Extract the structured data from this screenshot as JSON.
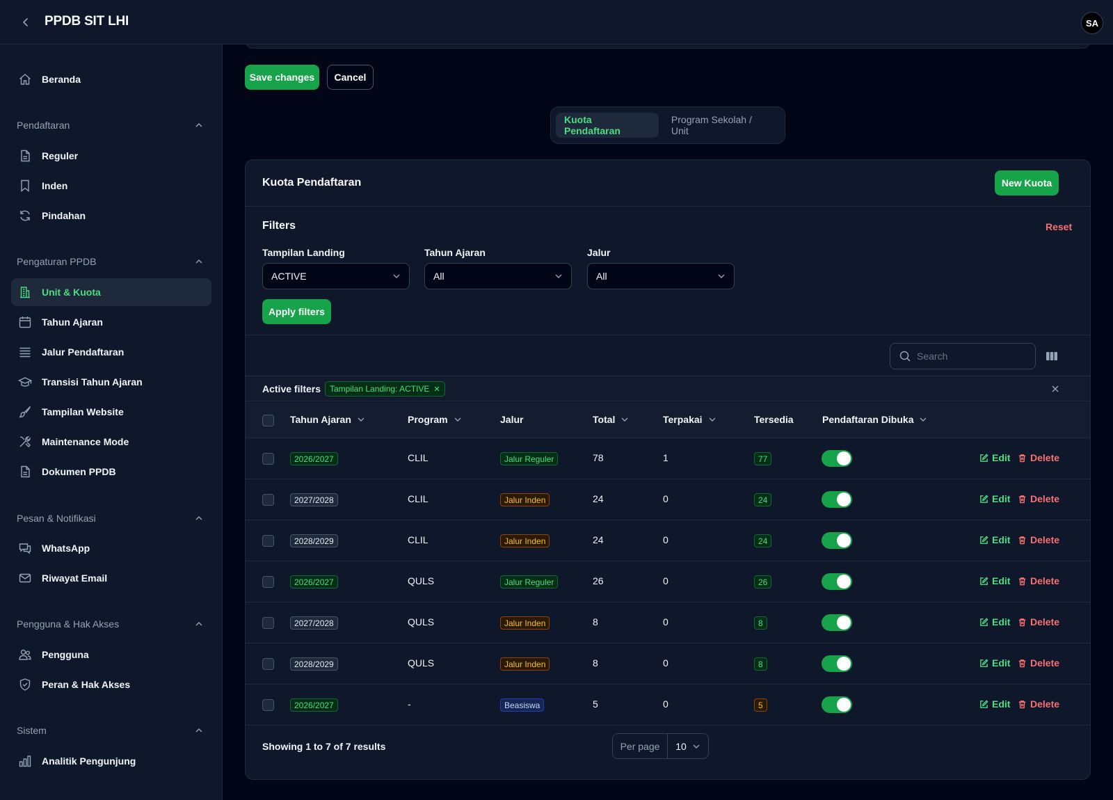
{
  "app": {
    "title": "PPDB SIT LHI",
    "avatar_initials": "SA"
  },
  "sidebar": {
    "home": {
      "label": "Beranda",
      "icon": "home-icon"
    },
    "groups": [
      {
        "label": "Pendaftaran",
        "items": [
          {
            "label": "Reguler",
            "icon": "document-icon"
          },
          {
            "label": "Inden",
            "icon": "bookmark-icon"
          },
          {
            "label": "Pindahan",
            "icon": "refresh-icon"
          }
        ]
      },
      {
        "label": "Pengaturan PPDB",
        "items": [
          {
            "label": "Unit & Kuota",
            "icon": "building-icon",
            "active": true
          },
          {
            "label": "Tahun Ajaran",
            "icon": "calendar-icon"
          },
          {
            "label": "Jalur Pendaftaran",
            "icon": "list-icon"
          },
          {
            "label": "Transisi Tahun Ajaran",
            "icon": "graduation-cap-icon"
          },
          {
            "label": "Tampilan Website",
            "icon": "brush-icon"
          },
          {
            "label": "Maintenance Mode",
            "icon": "wrench-screwdriver-icon"
          },
          {
            "label": "Dokumen PPDB",
            "icon": "document-icon"
          }
        ]
      },
      {
        "label": "Pesan & Notifikasi",
        "items": [
          {
            "label": "WhatsApp",
            "icon": "chat-icon"
          },
          {
            "label": "Riwayat Email",
            "icon": "envelope-icon"
          }
        ]
      },
      {
        "label": "Pengguna & Hak Akses",
        "items": [
          {
            "label": "Pengguna",
            "icon": "users-icon"
          },
          {
            "label": "Peran & Hak Akses",
            "icon": "shield-check-icon"
          }
        ]
      },
      {
        "label": "Sistem",
        "items": [
          {
            "label": "Analitik Pengunjung",
            "icon": "chart-bar-icon"
          }
        ]
      }
    ]
  },
  "actions": {
    "save_label": "Save changes",
    "cancel_label": "Cancel"
  },
  "tabs": [
    {
      "label": "Kuota Pendaftaran",
      "active": true
    },
    {
      "label": "Program Sekolah / Unit",
      "active": false
    }
  ],
  "card": {
    "title": "Kuota Pendaftaran",
    "new_button": "New Kuota",
    "filters_title": "Filters",
    "reset_label": "Reset",
    "filters": [
      {
        "label": "Tampilan Landing",
        "value": "ACTIVE"
      },
      {
        "label": "Tahun Ajaran",
        "value": "All"
      },
      {
        "label": "Jalur",
        "value": "All"
      }
    ],
    "apply_label": "Apply filters",
    "search_placeholder": "Search",
    "active_filters_label": "Active filters",
    "active_filter_chip": "Tampilan Landing: ACTIVE"
  },
  "table": {
    "headers": {
      "tahun_ajaran": "Tahun Ajaran",
      "program": "Program",
      "jalur": "Jalur",
      "total": "Total",
      "terpakai": "Terpakai",
      "tersedia": "Tersedia",
      "dibuka": "Pendaftaran Dibuka"
    },
    "edit_label": "Edit",
    "delete_label": "Delete",
    "rows": [
      {
        "tahun": "2026/2027",
        "tahun_style": "green",
        "program": "CLIL",
        "jalur": "Jalur Reguler",
        "jalur_style": "green",
        "total": "78",
        "terpakai": "1",
        "tersedia": "77",
        "tersedia_style": "green",
        "dibuka": true
      },
      {
        "tahun": "2027/2028",
        "tahun_style": "gray",
        "program": "CLIL",
        "jalur": "Jalur Inden",
        "jalur_style": "amber",
        "total": "24",
        "terpakai": "0",
        "tersedia": "24",
        "tersedia_style": "green",
        "dibuka": true
      },
      {
        "tahun": "2028/2029",
        "tahun_style": "gray",
        "program": "CLIL",
        "jalur": "Jalur Inden",
        "jalur_style": "amber",
        "total": "24",
        "terpakai": "0",
        "tersedia": "24",
        "tersedia_style": "green",
        "dibuka": true
      },
      {
        "tahun": "2026/2027",
        "tahun_style": "green",
        "program": "QULS",
        "jalur": "Jalur Reguler",
        "jalur_style": "green",
        "total": "26",
        "terpakai": "0",
        "tersedia": "26",
        "tersedia_style": "green",
        "dibuka": true
      },
      {
        "tahun": "2027/2028",
        "tahun_style": "gray",
        "program": "QULS",
        "jalur": "Jalur Inden",
        "jalur_style": "amber",
        "total": "8",
        "terpakai": "0",
        "tersedia": "8",
        "tersedia_style": "green",
        "dibuka": true
      },
      {
        "tahun": "2028/2029",
        "tahun_style": "gray",
        "program": "QULS",
        "jalur": "Jalur Inden",
        "jalur_style": "amber",
        "total": "8",
        "terpakai": "0",
        "tersedia": "8",
        "tersedia_style": "green",
        "dibuka": true
      },
      {
        "tahun": "2026/2027",
        "tahun_style": "green",
        "program": "-",
        "jalur": "Beasiswa",
        "jalur_style": "blue",
        "total": "5",
        "terpakai": "0",
        "tersedia": "5",
        "tersedia_style": "amber",
        "dibuka": true
      }
    ]
  },
  "footer": {
    "showing": "Showing 1 to 7 of 7 results",
    "per_page_label": "Per page",
    "per_page_value": "10"
  },
  "colors": {
    "accent": "#16a34a",
    "accent_text": "#4ade80",
    "danger": "#f87171",
    "background": "#020617",
    "surface": "#0f172a"
  }
}
